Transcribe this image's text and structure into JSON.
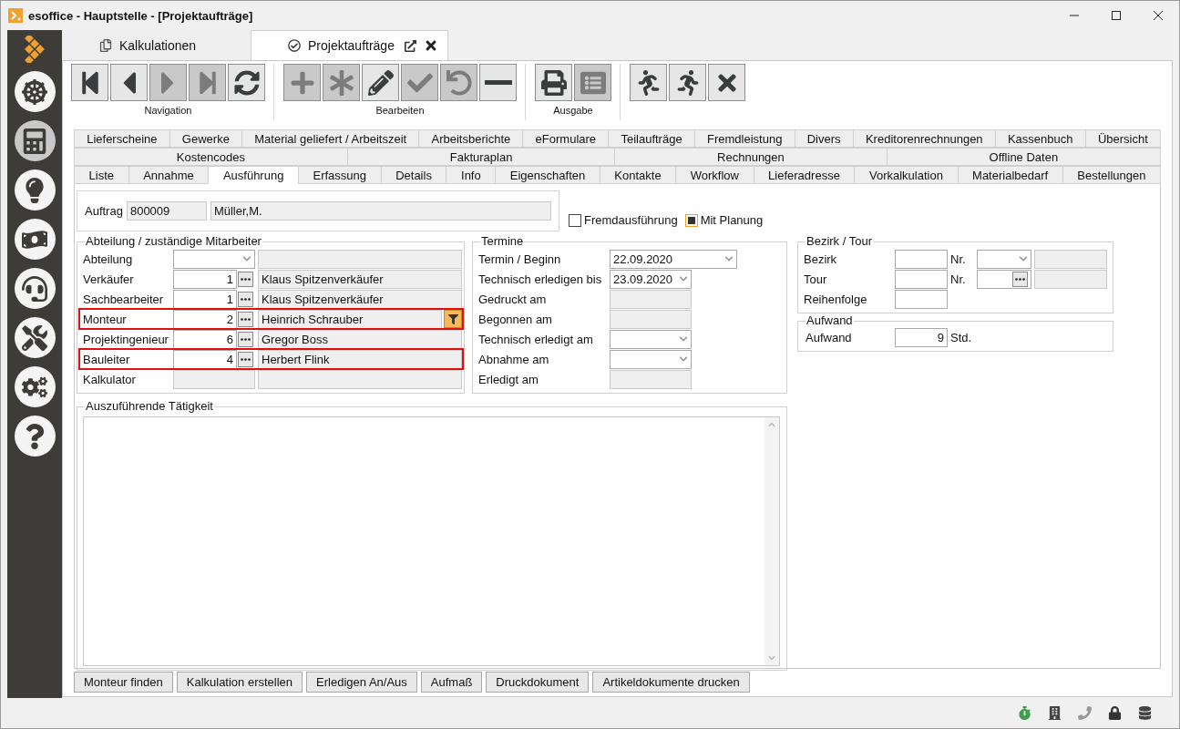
{
  "window": {
    "title": "esoffice - Hauptstelle - [Projektaufträge]"
  },
  "sidebar": {
    "items": [
      {
        "kind": "wheel",
        "selected": false
      },
      {
        "kind": "board",
        "selected": true
      },
      {
        "kind": "siren",
        "selected": false
      },
      {
        "kind": "money",
        "selected": false
      },
      {
        "kind": "headset",
        "selected": false
      },
      {
        "kind": "tools",
        "selected": false
      },
      {
        "kind": "gears",
        "selected": false
      },
      {
        "kind": "help",
        "selected": false
      }
    ]
  },
  "doc_tabs": [
    {
      "label": "Kalkulationen",
      "kind": "pages",
      "selected": false
    },
    {
      "label": "Projektaufträge",
      "kind": "check",
      "selected": true
    }
  ],
  "toolbar": [
    {
      "label": "Navigation",
      "buttons": [
        {
          "kind": "first",
          "disabled": false
        },
        {
          "kind": "prev",
          "disabled": false
        },
        {
          "kind": "next",
          "disabled": true
        },
        {
          "kind": "last",
          "disabled": true
        },
        {
          "kind": "refresh",
          "disabled": false
        }
      ]
    },
    {
      "label": "Bearbeiten",
      "buttons": [
        {
          "kind": "add",
          "disabled": true
        },
        {
          "kind": "asterisk",
          "disabled": true
        },
        {
          "kind": "edit",
          "disabled": false
        },
        {
          "kind": "check",
          "disabled": true
        },
        {
          "kind": "undo",
          "disabled": true
        },
        {
          "kind": "minus",
          "disabled": false
        }
      ]
    },
    {
      "label": "Ausgabe",
      "buttons": [
        {
          "kind": "print",
          "disabled": false
        },
        {
          "kind": "list",
          "disabled": true
        }
      ]
    },
    {
      "buttons": [
        {
          "kind": "run-left",
          "disabled": false
        },
        {
          "kind": "run-right",
          "disabled": false
        },
        {
          "kind": "close",
          "disabled": false
        }
      ]
    }
  ],
  "tab_rows": [
    [
      {
        "label": "Lieferscheine",
        "selected": false
      },
      {
        "label": "Gewerke",
        "selected": false
      },
      {
        "label": "Material geliefert / Arbeitszeit",
        "selected": false
      },
      {
        "label": "Arbeitsberichte",
        "selected": false
      },
      {
        "label": "eFormulare",
        "selected": false
      },
      {
        "label": "Teilaufträge",
        "selected": false
      },
      {
        "label": "Fremdleistung",
        "selected": false
      },
      {
        "label": "Divers",
        "selected": false
      },
      {
        "label": "Kreditorenrechnungen",
        "selected": false
      },
      {
        "label": "Kassenbuch",
        "selected": false
      },
      {
        "label": "Übersicht",
        "selected": false
      }
    ],
    [
      {
        "label": "Kostencodes",
        "selected": false
      },
      {
        "label": "Fakturaplan",
        "selected": false
      },
      {
        "label": "Rechnungen",
        "selected": false
      },
      {
        "label": "Offline Daten",
        "selected": false
      }
    ],
    [
      {
        "label": "Liste",
        "selected": false
      },
      {
        "label": "Annahme",
        "selected": false
      },
      {
        "label": "Ausführung",
        "selected": true
      },
      {
        "label": "Erfassung",
        "selected": false
      },
      {
        "label": "Details",
        "selected": false
      },
      {
        "label": "Info",
        "selected": false
      },
      {
        "label": "Eigenschaften",
        "selected": false
      },
      {
        "label": "Kontakte",
        "selected": false
      },
      {
        "label": "Workflow",
        "selected": false
      },
      {
        "label": "Lieferadresse",
        "selected": false
      },
      {
        "label": "Vorkalkulation",
        "selected": false
      },
      {
        "label": "Materialbedarf",
        "selected": false
      },
      {
        "label": "Bestellungen",
        "selected": false
      }
    ]
  ],
  "auftrag": {
    "label": "Auftrag",
    "number": "800009",
    "name": "Müller,M."
  },
  "checkboxes": [
    {
      "label": "Fremdausführung",
      "checked": false
    },
    {
      "label": "Mit Planung",
      "checked": true
    }
  ],
  "staff": {
    "title": "Abteilung / zuständige Mitarbeiter",
    "rows": [
      {
        "label": "Abteilung",
        "kind": "select",
        "highlighted": false,
        "filter": false
      },
      {
        "label": "Verkäufer",
        "kind": "lookup",
        "number": "1",
        "name": "Klaus Spitzenverkäufer",
        "highlighted": false,
        "filter": false
      },
      {
        "label": "Sachbearbeiter",
        "kind": "lookup",
        "number": "1",
        "name": "Klaus Spitzenverkäufer",
        "highlighted": false,
        "filter": false
      },
      {
        "label": "Monteur",
        "kind": "lookup",
        "number": "2",
        "name": "Heinrich Schrauber",
        "highlighted": true,
        "filter": true
      },
      {
        "label": "Projektingenieur",
        "kind": "lookup",
        "number": "6",
        "name": "Gregor Boss",
        "highlighted": false,
        "filter": false
      },
      {
        "label": "Bauleiter",
        "kind": "lookup",
        "number": "4",
        "name": "Herbert Flink",
        "highlighted": true,
        "filter": false
      },
      {
        "label": "Kalkulator",
        "kind": "readonly",
        "highlighted": false,
        "filter": false
      }
    ]
  },
  "termine": {
    "title": "Termine",
    "rows": [
      {
        "label": "Termin / Beginn",
        "kind": "dropdown",
        "wide": true,
        "value": "22.09.2020"
      },
      {
        "label": "Technisch erledigen bis",
        "kind": "dropdown",
        "wide": false,
        "value": "23.09.2020"
      },
      {
        "label": "Gedruckt am",
        "kind": "readonly",
        "wide": false
      },
      {
        "label": "Begonnen am",
        "kind": "readonly",
        "wide": false
      },
      {
        "label": "Technisch erledigt am",
        "kind": "dropdown",
        "wide": false
      },
      {
        "label": "Abnahme am",
        "kind": "dropdown",
        "wide": false
      },
      {
        "label": "Erledigt am",
        "kind": "readonly",
        "wide": false
      }
    ]
  },
  "bezirk": {
    "title": "Bezirk / Tour",
    "rows": [
      {
        "label": "Bezirk",
        "kind": "select",
        "nr_label": "Nr."
      },
      {
        "label": "Tour",
        "kind": "lookup",
        "nr_label": "Nr."
      },
      {
        "label": "Reihenfolge",
        "kind": "plain"
      }
    ]
  },
  "aufwand": {
    "title": "Aufwand",
    "label": "Aufwand",
    "value": "9",
    "unit": "Std."
  },
  "taetigkeit": {
    "title": "Auszuführende Tätigkeit"
  },
  "actions": [
    "Monteur finden",
    "Kalkulation erstellen",
    "Erledigen An/Aus",
    "Aufmaß",
    "Druckdokument",
    "Artikeldokumente drucken"
  ],
  "status_icons": [
    {
      "kind": "timer"
    },
    {
      "kind": "building"
    },
    {
      "kind": "phone"
    },
    {
      "kind": "lock"
    },
    {
      "kind": "database"
    }
  ]
}
